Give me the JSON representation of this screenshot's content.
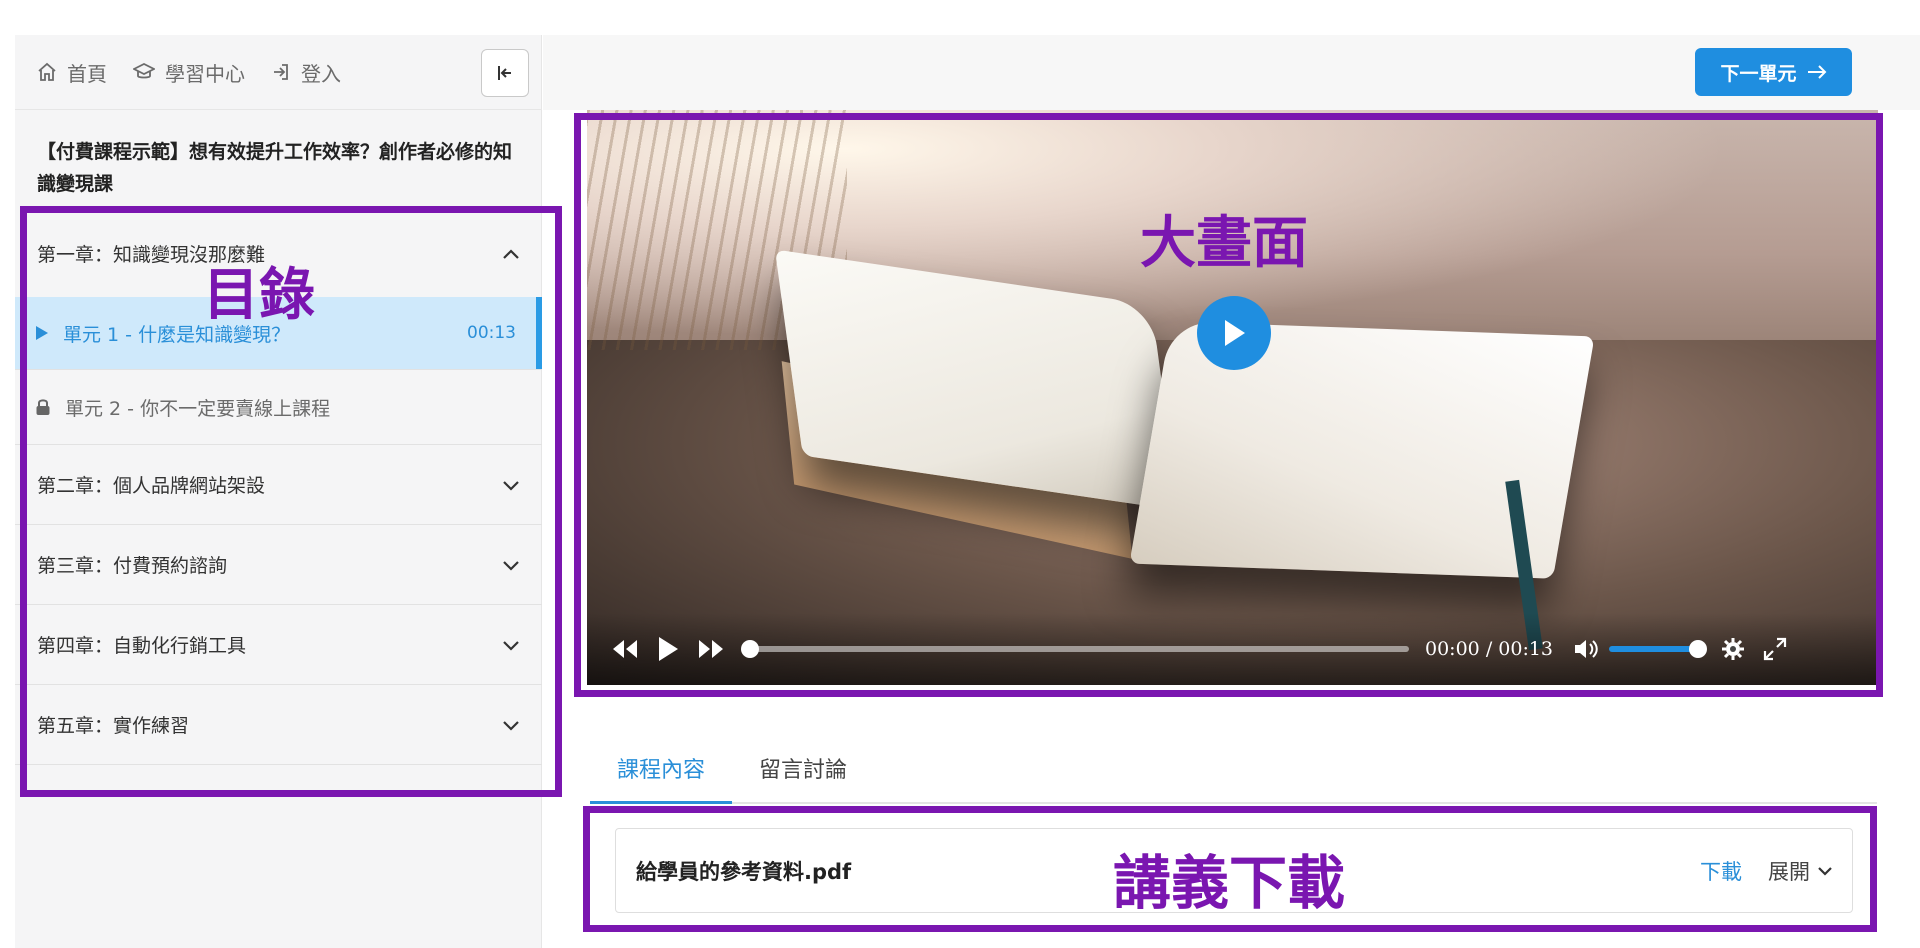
{
  "nav": {
    "home": "首頁",
    "learning_center": "學習中心",
    "login": "登入"
  },
  "course": {
    "title": "【付費課程示範】想有效提升工作效率？創作者必修的知識變現課"
  },
  "toc": {
    "chapters": [
      {
        "label": "第一章：知識變現沒那麼難",
        "expanded": true,
        "units": [
          {
            "label": "單元 1 - 什麼是知識變現？",
            "duration": "00:13",
            "state": "playing"
          },
          {
            "label": "單元 2 - 你不一定要賣線上課程",
            "state": "locked"
          }
        ]
      },
      {
        "label": "第二章：個人品牌網站架設",
        "expanded": false
      },
      {
        "label": "第三章：付費預約諮詢",
        "expanded": false
      },
      {
        "label": "第四章：自動化行銷工具",
        "expanded": false
      },
      {
        "label": "第五章：實作練習",
        "expanded": false
      }
    ]
  },
  "header": {
    "next_unit": "下一單元"
  },
  "player": {
    "current_time": "00:00",
    "separator": "/",
    "duration": "00:13",
    "progress": 0,
    "volume": 1.0
  },
  "tabs": [
    {
      "label": "課程內容",
      "active": true
    },
    {
      "label": "留言討論",
      "active": false
    }
  ],
  "attachment": {
    "filename": "給學員的參考資料.pdf",
    "download": "下載",
    "expand": "展開"
  },
  "annotations": {
    "toc": "目錄",
    "video": "大畫面",
    "handout": "講義下載",
    "color": "#7a16b0"
  },
  "colors": {
    "accent": "#1f8ee0",
    "active_unit_bg": "#cfe9fb"
  },
  "icons": [
    "home-icon",
    "graduation-cap-icon",
    "login-icon",
    "collapse-sidebar-icon",
    "chevron-up-icon",
    "chevron-down-icon",
    "play-icon",
    "lock-icon",
    "arrow-right-icon",
    "rewind-icon",
    "fast-forward-icon",
    "volume-icon",
    "settings-icon",
    "fullscreen-icon"
  ]
}
